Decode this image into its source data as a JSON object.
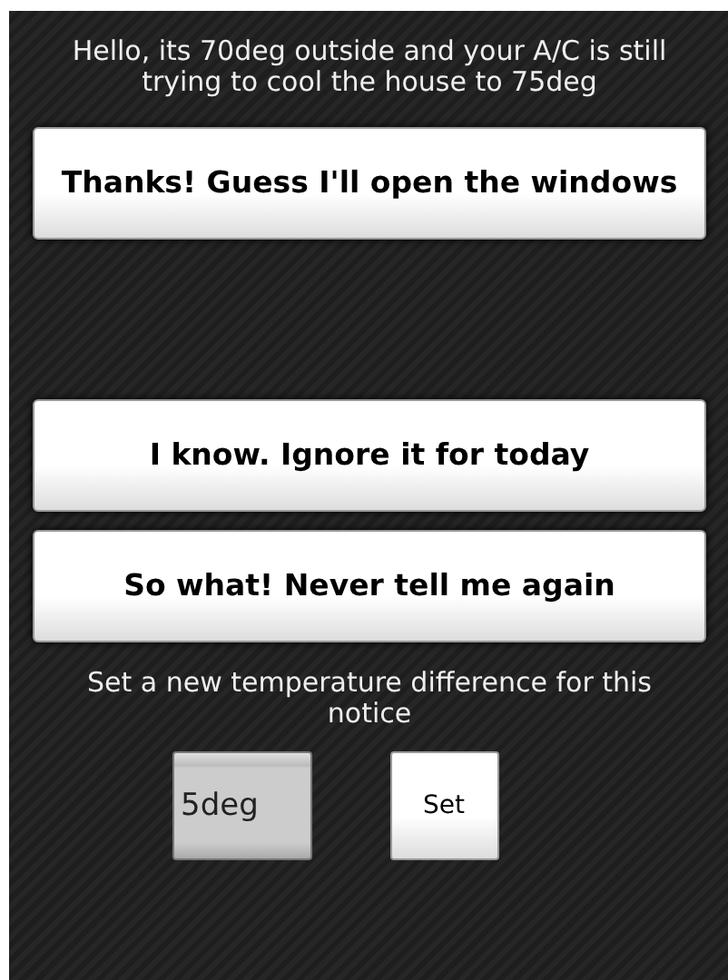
{
  "message": "Hello, its 70deg outside and your A/C is still trying to cool the house to 75deg",
  "buttons": [
    {
      "label": "Thanks! Guess I'll open the windows"
    },
    {
      "label": "I know. Ignore it for today"
    },
    {
      "label": "So what! Never tell me again"
    }
  ],
  "prompt": "Set a new temperature difference for this notice",
  "difference_field": {
    "value": "5deg"
  },
  "set_button": {
    "label": "Set"
  }
}
